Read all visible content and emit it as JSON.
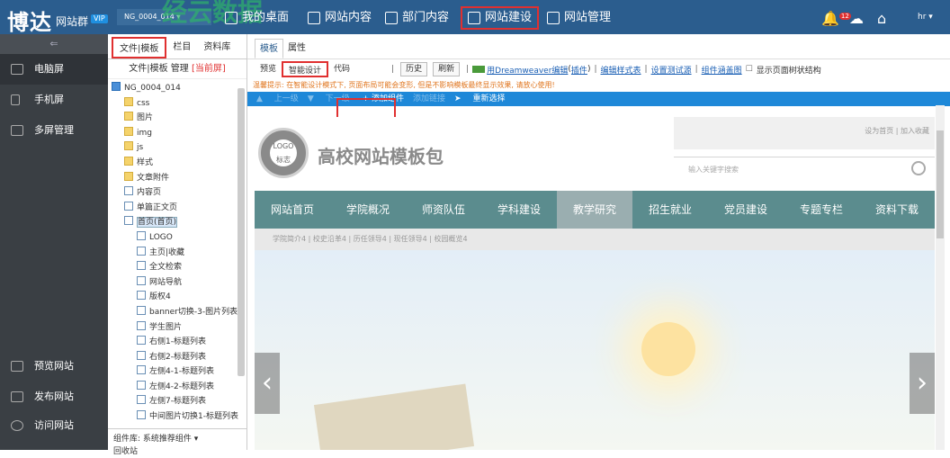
{
  "header": {
    "logo": "博达",
    "logo_sub": "网站群",
    "vip": "VIP",
    "watermark": "经云数据",
    "site_selector": "NG_0004_014",
    "nav": [
      "我的桌面",
      "网站内容",
      "部门内容",
      "网站建设",
      "网站管理"
    ],
    "notify_count": "12",
    "user": "hr"
  },
  "sidebar": {
    "items": [
      "电脑屏",
      "手机屏",
      "多屏管理"
    ],
    "bottom_items": [
      "预览网站",
      "发布网站",
      "访问网站"
    ]
  },
  "filetree": {
    "tabs": [
      "文件|模板",
      "栏目",
      "资料库"
    ],
    "subtitle": "文件|模板 管理",
    "subtitle_mark": "[当前屏]",
    "rows": [
      {
        "label": "NG_0004_014",
        "icon": "mon",
        "indent": 0
      },
      {
        "label": "css",
        "icon": "fold",
        "indent": 1
      },
      {
        "label": "图片",
        "icon": "fold",
        "indent": 1
      },
      {
        "label": "img",
        "icon": "fold",
        "indent": 1
      },
      {
        "label": "js",
        "icon": "fold",
        "indent": 1
      },
      {
        "label": "样式",
        "icon": "fold",
        "indent": 1
      },
      {
        "label": "文章附件",
        "icon": "fold",
        "indent": 1
      },
      {
        "label": "内容页",
        "icon": "pg",
        "indent": 1
      },
      {
        "label": "单篇正文页",
        "icon": "pg",
        "indent": 1
      },
      {
        "label": "首页(首页)",
        "icon": "pg",
        "indent": 1
      },
      {
        "label": "LOGO",
        "icon": "pg",
        "indent": 2
      },
      {
        "label": "主页|收藏",
        "icon": "pg",
        "indent": 2
      },
      {
        "label": "全文检索",
        "icon": "pg",
        "indent": 2
      },
      {
        "label": "网站导航",
        "icon": "pg",
        "indent": 2
      },
      {
        "label": "版权4",
        "icon": "pg",
        "indent": 2
      },
      {
        "label": "banner切换-3-图片列表",
        "icon": "pg",
        "indent": 2
      },
      {
        "label": "学生图片",
        "icon": "pg",
        "indent": 2
      },
      {
        "label": "右侧1-标题列表",
        "icon": "pg",
        "indent": 2
      },
      {
        "label": "右侧2-标题列表",
        "icon": "pg",
        "indent": 2
      },
      {
        "label": "左侧4-1-标题列表",
        "icon": "pg",
        "indent": 2
      },
      {
        "label": "左侧4-2-标题列表",
        "icon": "pg",
        "indent": 2
      },
      {
        "label": "左侧7-标题列表",
        "icon": "pg",
        "indent": 2
      },
      {
        "label": "中间图片切换1-标题列表",
        "icon": "pg",
        "indent": 2
      }
    ],
    "bottom_label": "组件库: 系统推荐组件",
    "bottom_label2": "回收站"
  },
  "main": {
    "tabs": [
      "模板",
      "属性"
    ],
    "toolbar": {
      "preview": "预览",
      "smart": "智能设计",
      "code": "代码",
      "history": "历史",
      "refresh": "刷新",
      "dw": "用Dreamweaver编辑",
      "plugin": "插件",
      "edit_style": "编辑样式表",
      "test_env": "设置测试源",
      "map": "组件涵盖图",
      "show_tree": "显示页面树状结构"
    },
    "warning": "温馨提示: 在智能设计模式下, 页面布局可能会变形, 但是不影响模板最终显示效果, 请放心使用!",
    "bar": {
      "prev": "上一级",
      "next": "下一级",
      "add": "+ 添加组件",
      "add_related": "添加链接",
      "reselect": "重新选择"
    }
  },
  "preview": {
    "logo_text": "LOGO",
    "logo_text2": "标志",
    "title": "高校网站模板包",
    "top_links": "设为首页 | 加入收藏",
    "search_placeholder": "输入关键字搜索",
    "nav": [
      "网站首页",
      "学院概况",
      "师资队伍",
      "学科建设",
      "教学研究",
      "招生就业",
      "党员建设",
      "专题专栏",
      "资料下载"
    ],
    "subnav": "学院简介4   |   校史沿革4   |   历任领导4   |   现任领导4   |   校园概览4"
  }
}
